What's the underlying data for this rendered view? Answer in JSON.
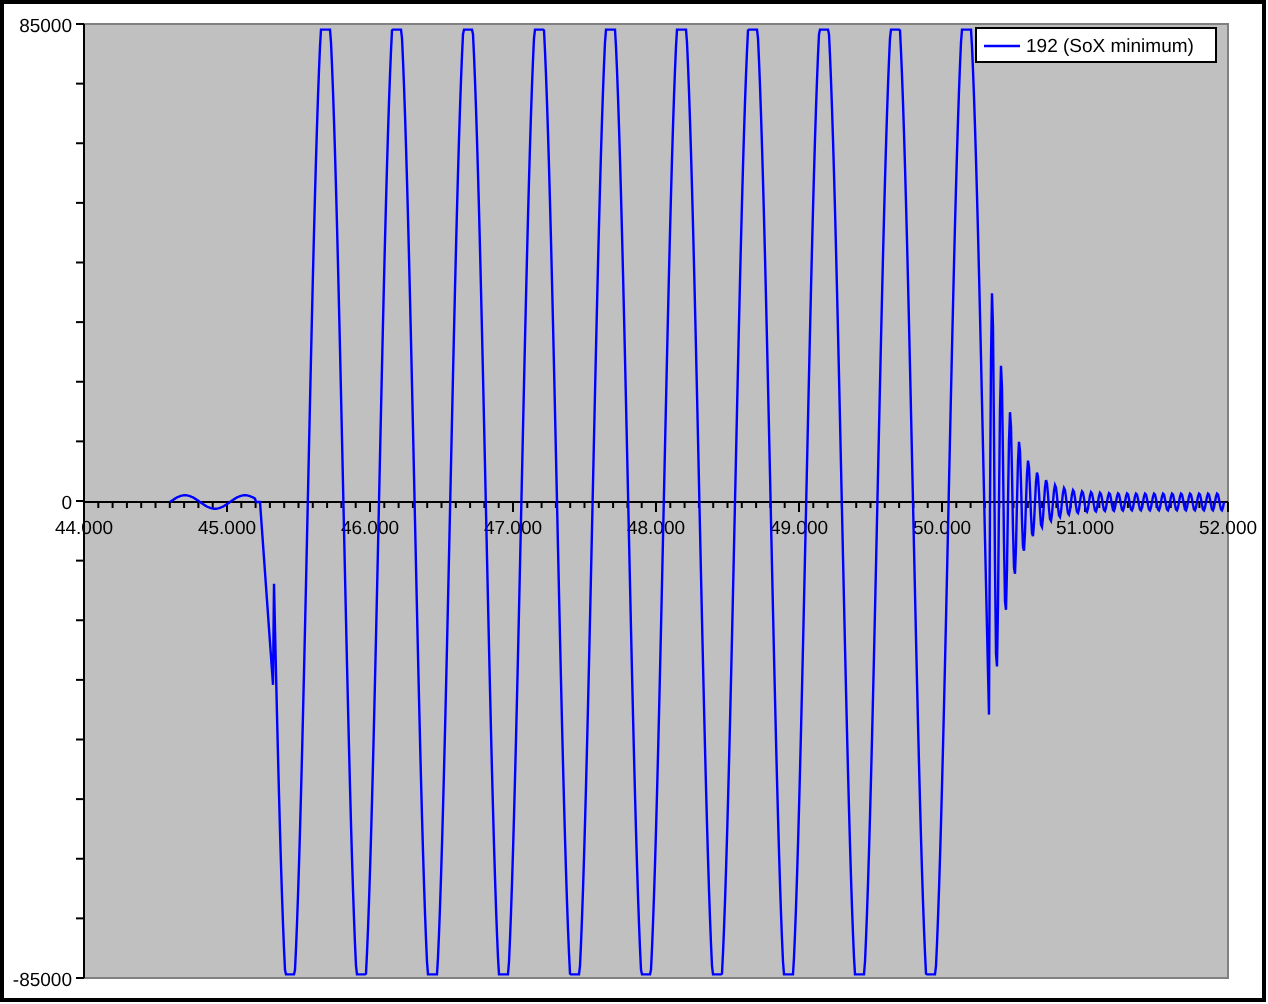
{
  "chart": {
    "y_labels": [
      "85000",
      "0",
      "-85000"
    ],
    "x_labels": [
      "44.000",
      "45.000",
      "46.000",
      "47.000",
      "48.000",
      "49.000",
      "50.000",
      "51.000",
      "52.000"
    ],
    "legend": [
      {
        "label": "192 (SoX minimum)"
      }
    ]
  }
}
